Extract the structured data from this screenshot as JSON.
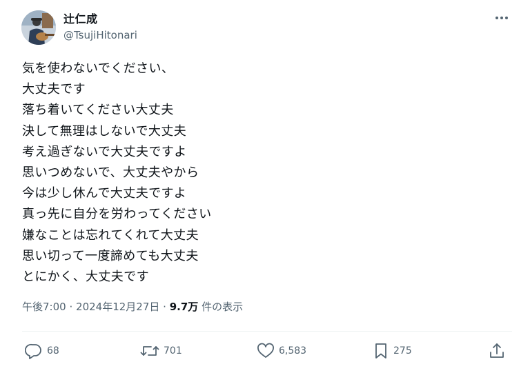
{
  "author": {
    "display_name": "辻仁成",
    "handle": "@TsujiHitonari"
  },
  "icons": {
    "more": "more-horizontal-icon",
    "reply": "reply-bubble-icon",
    "repost": "repost-icon",
    "like": "heart-icon",
    "bookmark": "bookmark-icon",
    "share": "share-upload-icon"
  },
  "tweet": {
    "lines": [
      "気を使わないでください、",
      "大丈夫です",
      "落ち着いてください大丈夫",
      "決して無理はしないで大丈夫",
      "考え過ぎないで大丈夫ですよ",
      "思いつめないで、大丈夫やから",
      "今は少し休んで大丈夫ですよ",
      "真っ先に自分を労わってください",
      "嫌なことは忘れてくれて大丈夫",
      "思い切って一度諦めても大丈夫",
      "とにかく、大丈夫です"
    ]
  },
  "meta": {
    "time": "午後7:00",
    "separator": "·",
    "date": "2024年12月27日",
    "views_count": "9.7万",
    "views_label": "件の表示"
  },
  "actions": {
    "replies": "68",
    "reposts": "701",
    "likes": "6,583",
    "bookmarks": "275"
  },
  "colors": {
    "text": "#0f1419",
    "secondary": "#536471",
    "divider": "#eff3f4"
  }
}
